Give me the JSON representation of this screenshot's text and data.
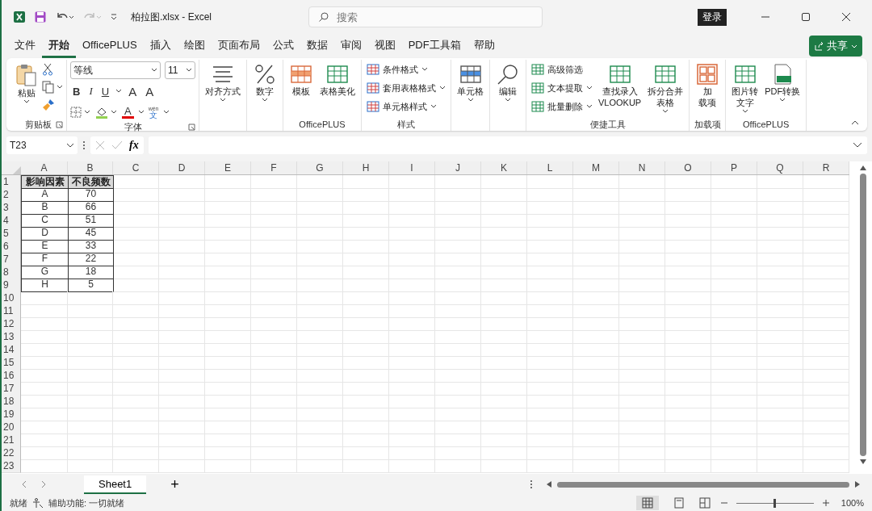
{
  "window": {
    "title": "柏拉图.xlsx  -  Excel",
    "search": {
      "placeholder": "搜索"
    },
    "login": "登录"
  },
  "tabs": [
    {
      "label": "文件",
      "selected": false
    },
    {
      "label": "开始",
      "selected": true
    },
    {
      "label": "OfficePLUS",
      "selected": false
    },
    {
      "label": "插入",
      "selected": false
    },
    {
      "label": "绘图",
      "selected": false
    },
    {
      "label": "页面布局",
      "selected": false
    },
    {
      "label": "公式",
      "selected": false
    },
    {
      "label": "数据",
      "selected": false
    },
    {
      "label": "审阅",
      "selected": false
    },
    {
      "label": "视图",
      "selected": false
    },
    {
      "label": "PDF工具箱",
      "selected": false
    },
    {
      "label": "帮助",
      "selected": false
    }
  ],
  "share": "共享",
  "ribbon": [
    {
      "kind": "clipboard",
      "label": "剪贴板",
      "paste": "粘贴"
    },
    {
      "kind": "font",
      "label": "字体",
      "font": "等线",
      "size": "11",
      "styles": [
        "B",
        "I",
        "U"
      ],
      "grow": [
        "A",
        "A"
      ],
      "color_letter": "A",
      "phonetic": [
        "wén",
        "文"
      ]
    },
    {
      "kind": "large",
      "items": [
        {
          "lines": [
            "对齐方式"
          ],
          "dropdown": true
        }
      ]
    },
    {
      "kind": "large",
      "items": [
        {
          "lines": [
            "数字"
          ],
          "dropdown": true
        }
      ]
    },
    {
      "kind": "large",
      "label": "OfficePLUS",
      "items": [
        {
          "lines": [
            "模板"
          ],
          "dropdown": false
        },
        {
          "lines": [
            "表格美化"
          ],
          "dropdown": false
        }
      ]
    },
    {
      "kind": "list",
      "label": "样式",
      "list": [
        {
          "label": "条件格式",
          "dropdown": true
        },
        {
          "label": "套用表格格式",
          "dropdown": true
        },
        {
          "label": "单元格样式",
          "dropdown": true
        }
      ]
    },
    {
      "kind": "large",
      "items": [
        {
          "lines": [
            "单元格"
          ],
          "dropdown": true
        }
      ]
    },
    {
      "kind": "large",
      "items": [
        {
          "lines": [
            "编辑"
          ],
          "dropdown": true
        }
      ]
    },
    {
      "kind": "tools",
      "label": "便捷工具",
      "list": [
        {
          "label": "高级筛选",
          "dropdown": false
        },
        {
          "label": "文本提取",
          "dropdown": true
        },
        {
          "label": "批量删除",
          "dropdown": true
        }
      ],
      "items": [
        {
          "lines": [
            "查找录入",
            "VLOOKUP"
          ],
          "dropdown": false
        },
        {
          "lines": [
            "拆分合并",
            "表格"
          ],
          "dropdown": true
        }
      ]
    },
    {
      "kind": "large",
      "label": "加载项",
      "items": [
        {
          "lines": [
            "加",
            "载项"
          ],
          "dropdown": false
        }
      ]
    },
    {
      "kind": "large",
      "label": "OfficePLUS",
      "items": [
        {
          "lines": [
            "图片转",
            "文字"
          ],
          "dropdown": true
        },
        {
          "lines": [
            "PDF转换"
          ],
          "dropdown": true
        }
      ]
    }
  ],
  "formula_bar": {
    "name_box": "T23",
    "fx": "fx"
  },
  "sheet": {
    "columns": [
      "A",
      "B",
      "C",
      "D",
      "E",
      "F",
      "G",
      "H",
      "I",
      "J",
      "K",
      "L",
      "M",
      "N",
      "O",
      "P",
      "Q",
      "R"
    ],
    "row_numbers": [
      "1",
      "2",
      "3",
      "4",
      "5",
      "6",
      "7",
      "8",
      "9",
      "10",
      "11",
      "12",
      "13",
      "14",
      "15",
      "16",
      "17",
      "18",
      "19",
      "20",
      "21",
      "22",
      "23"
    ],
    "header": [
      "影响因素",
      "不良频数"
    ],
    "rows": [
      [
        "A",
        "70"
      ],
      [
        "B",
        "66"
      ],
      [
        "C",
        "51"
      ],
      [
        "D",
        "45"
      ],
      [
        "E",
        "33"
      ],
      [
        "F",
        "22"
      ],
      [
        "G",
        "18"
      ],
      [
        "H",
        "5"
      ]
    ]
  },
  "sheet_tabs": [
    {
      "label": "Sheet1",
      "selected": true
    }
  ],
  "add_sheet": "+",
  "status_bar": {
    "ready": "就绪",
    "accessibility": "辅助功能: 一切就绪",
    "zoom": {
      "level": 0.5,
      "reading": "100%"
    }
  }
}
